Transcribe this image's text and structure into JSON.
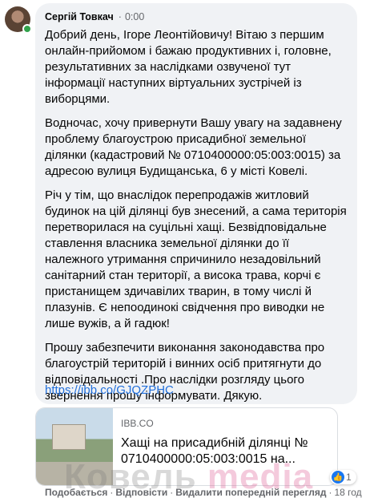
{
  "comment": {
    "author": "Сергій Товкач",
    "separator": "·",
    "time": "0:00",
    "paragraphs": [
      "Добрий день, Ігоре Леонтійовичу! Вітаю з першим онлайн-прийомом і бажаю продуктивних і, головне, результативних за наслідками озвученої тут інформації наступних віртуальних зустрічей із виборцями.",
      "Водночас, хочу привернути Вашу увагу на задавнену проблему благоустрою присадибної земельної ділянки (кадастровий № 0710400000:05:003:0015) за адресою вулиця Будищанська, 6 у місті Ковелі.",
      "Річ у тім, що внаслідок перепродажів житловий будинок на цій ділянці був знесений, а сама територія перетворилася на суцільні хащі. Безвідповідальне ставлення власника земельної ділянки до її належного утримання спричинило незадовільний санітарний стан території, а висока трава, корчі є пристанищем здичавілих тварин, в тому числі й плазунів. Є непоодинокі свідчення про виводки не лише вужів, а й гадюк!",
      "Прошу забезпечити виконання законодавства про благоустрій територій і винних осіб притягнути до відповідальності .Про наслідки розгляду цього звернення прошу інформувати. Дякую."
    ],
    "link": "https://ibb.co/GJQZPHC",
    "preview": {
      "domain": "IBB.CO",
      "title": "Хащі на присадибній ділянці № 0710400000:05:003:0015 на..."
    },
    "reactions": {
      "count": "1",
      "icon": "like-icon",
      "color": "#1877f2"
    },
    "actions": {
      "like": "Подобається",
      "reply": "Відповісти",
      "translation": "Видалити попередній перегляд",
      "age": "18 год"
    }
  },
  "watermark": {
    "part1": "Ковель ",
    "part2": "media"
  }
}
